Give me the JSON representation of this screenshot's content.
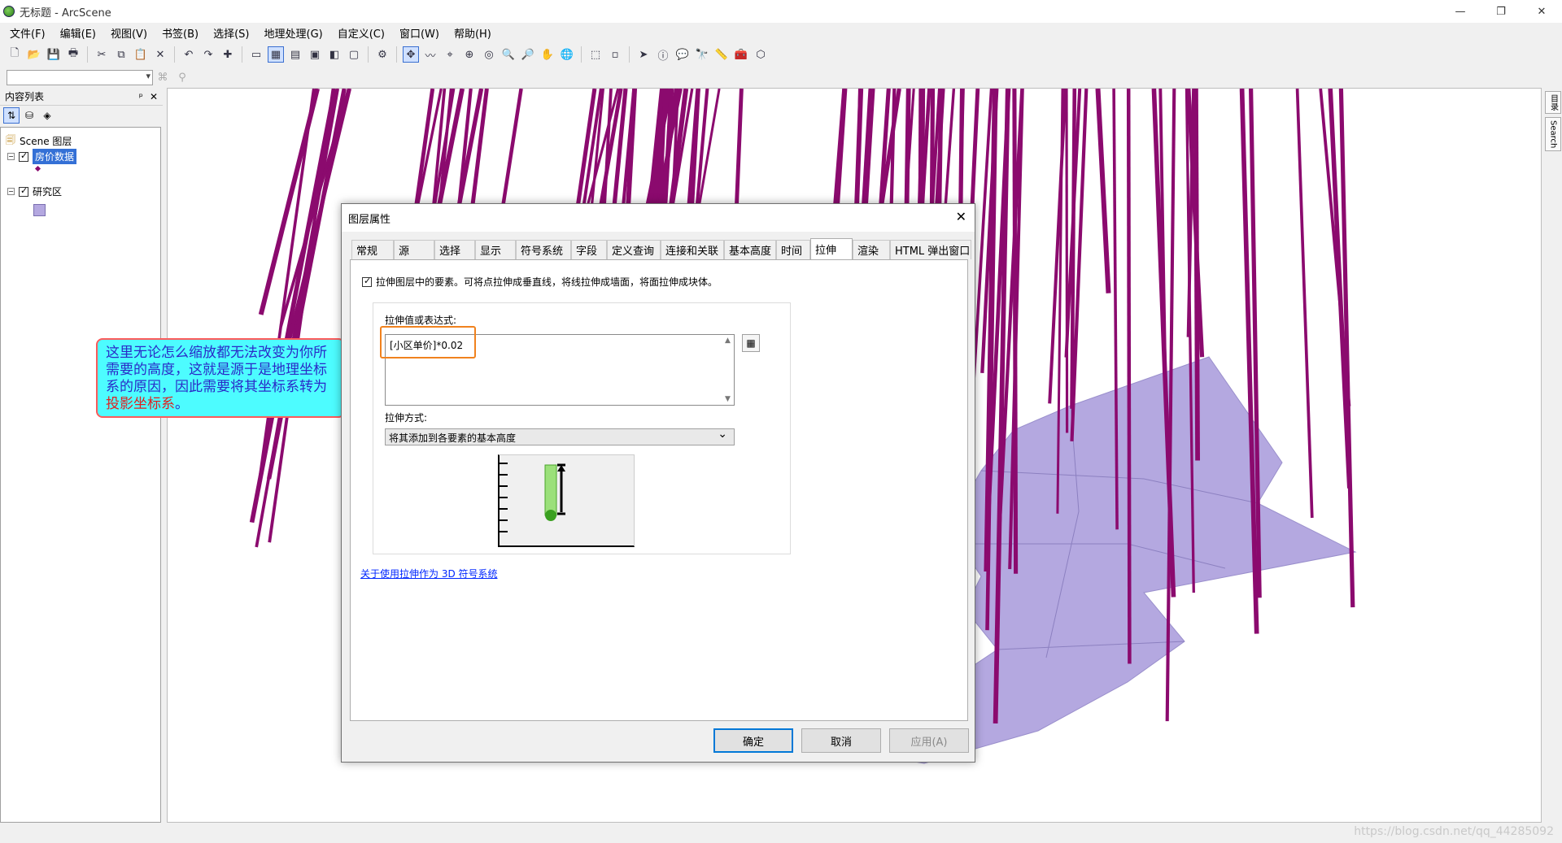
{
  "window": {
    "title": "无标题 - ArcScene",
    "minimize": "—",
    "restore": "❐",
    "close": "✕"
  },
  "menu": [
    "文件(F)",
    "编辑(E)",
    "视图(V)",
    "书签(B)",
    "选择(S)",
    "地理处理(G)",
    "自定义(C)",
    "窗口(W)",
    "帮助(H)"
  ],
  "toc": {
    "title": "内容列表",
    "pin": "ᵖ",
    "close": "✕",
    "root": "Scene 图层",
    "layers": [
      {
        "name": "房价数据",
        "checked": true,
        "selected": true
      },
      {
        "name": "研究区",
        "checked": true,
        "selected": false
      }
    ]
  },
  "right_rail": [
    "目录",
    "Search"
  ],
  "callout": {
    "text": "这里无论怎么缩放都无法改变为你所需要的高度，这就是源于是地理坐标系的原因，因此需要将其坐标系转为",
    "highlight": "投影坐标系",
    "end": "。"
  },
  "dialog": {
    "title": "图层属性",
    "close": "✕",
    "tabs": [
      "常规",
      "源",
      "选择",
      "显示",
      "符号系统",
      "字段",
      "定义查询",
      "连接和关联",
      "基本高度",
      "时间",
      "拉伸",
      "渲染",
      "HTML 弹出窗口"
    ],
    "active_tab": "拉伸",
    "extrude_checkbox_label": "拉伸图层中的要素。可将点拉伸成垂直线，将线拉伸成墙面，将面拉伸成块体。",
    "extrude_checked": true,
    "expression_label": "拉伸值或表达式:",
    "expression_value": "[小区单价]*0.02",
    "method_label": "拉伸方式:",
    "method_value": "将其添加到各要素的基本高度",
    "help_link": "关于使用拉伸作为 3D 符号系统",
    "buttons": {
      "ok": "确定",
      "cancel": "取消",
      "apply": "应用(A)"
    }
  },
  "watermark": "https://blog.csdn.net/qq_44285092",
  "colors": {
    "bars": "#8b0a6e",
    "polygon": "#b4a8e0",
    "selection": "#3470d6",
    "callout_fill": "#4dfcff",
    "callout_border": "#ff5a5a",
    "highlight_box": "#f0821e"
  }
}
